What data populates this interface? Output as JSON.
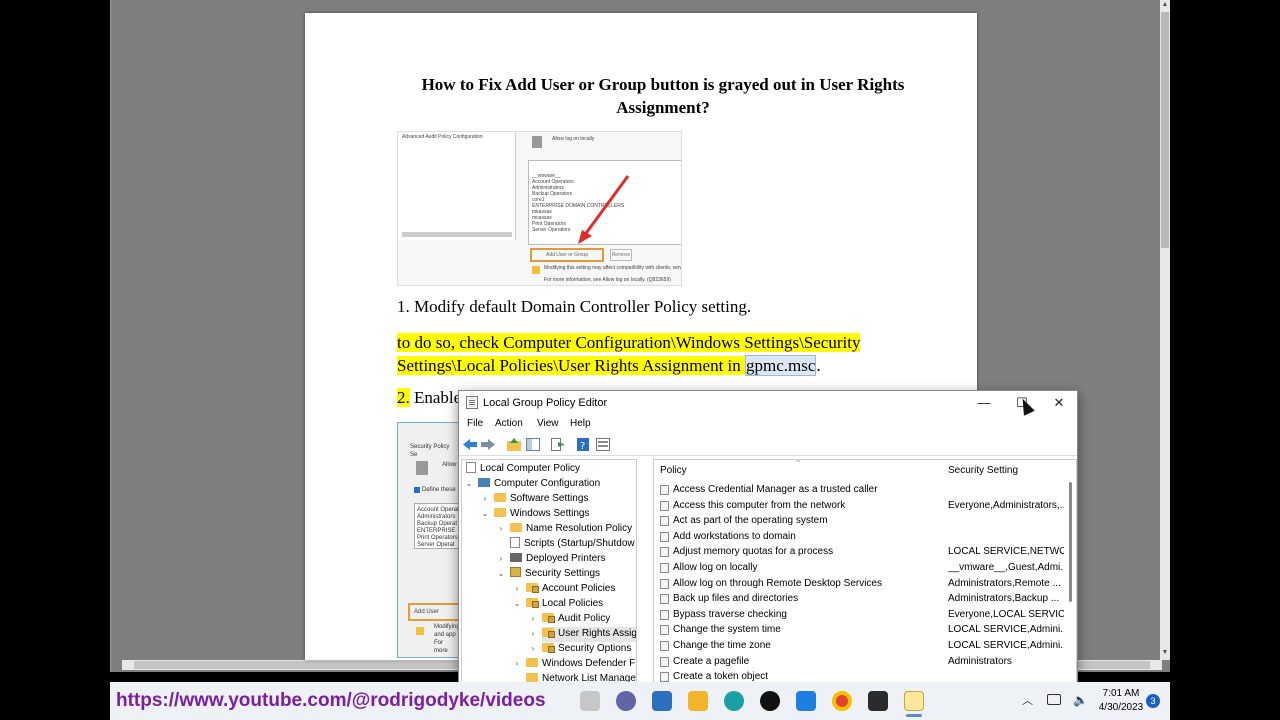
{
  "document": {
    "title": "How to Fix Add User or Group button is grayed out in User Rights Assignment?",
    "step1": "1. Modify default Domain Controller Policy setting.",
    "para_part1": "to do so, check Computer Configuration\\Windows Settings\\Security Settings\\Local Policies\\User Rights Assignment in ",
    "para_selected": "gpmc.msc",
    "para_end": ".",
    "step2_num": "2.",
    "step2_text": " Enable"
  },
  "screenshot1": {
    "tree_label": "Advanced Audit Policy Configuration",
    "policy_label": "Allow log on locally",
    "members": [
      "__vmware__",
      "Account Operators",
      "Administrators",
      "Backup Operators",
      "core1",
      "ENTERPRISE DOMAIN CONTROLLERS",
      "mkassas",
      "mcassas",
      "Print Operators",
      "Server Operators"
    ],
    "add_button": "Add User or Group",
    "remove_button": "Remove",
    "note": "Modifying this setting may affect compatibility with clients, services and applications.",
    "more_info": "For more information, see Allow log on locally. (Q823659)"
  },
  "screenshot2": {
    "title": "Security Policy Se",
    "allow": "Allow",
    "define": "Define these",
    "members": [
      "Account Operat",
      "Administrators",
      "Backup Operat",
      "ENTERPRISE",
      "Print Operators",
      "Server Operat"
    ],
    "add_button": "Add User",
    "modify_note": "Modifying",
    "and_app": "and app",
    "for_more": "For more"
  },
  "gpe_window": {
    "title": "Local Group Policy Editor",
    "minimize": "—",
    "maximize": "☐",
    "close": "✕",
    "menu": [
      "File",
      "Action",
      "View",
      "Help"
    ],
    "tree": {
      "root": "Local Computer Policy",
      "computer_config": "Computer Configuration",
      "software_settings": "Software Settings",
      "windows_settings": "Windows Settings",
      "name_resolution": "Name Resolution Policy",
      "scripts": "Scripts (Startup/Shutdow",
      "deployed_printers": "Deployed Printers",
      "security_settings": "Security Settings",
      "account_policies": "Account Policies",
      "local_policies": "Local Policies",
      "audit_policy": "Audit Policy",
      "user_rights": "User Rights Assigi",
      "security_options": "Security Options",
      "windows_defender": "Windows Defender Fi",
      "network_list": "Network List Manage"
    },
    "list_headers": {
      "policy": "Policy",
      "setting": "Security Setting"
    },
    "rows": [
      {
        "policy": "Access Credential Manager as a trusted caller",
        "setting": ""
      },
      {
        "policy": "Access this computer from the network",
        "setting": "Everyone,Administrators,..."
      },
      {
        "policy": "Act as part of the operating system",
        "setting": ""
      },
      {
        "policy": "Add workstations to domain",
        "setting": ""
      },
      {
        "policy": "Adjust memory quotas for a process",
        "setting": "LOCAL SERVICE,NETWO..."
      },
      {
        "policy": "Allow log on locally",
        "setting": "__vmware__,Guest,Admi..."
      },
      {
        "policy": "Allow log on through Remote Desktop Services",
        "setting": "Administrators,Remote ..."
      },
      {
        "policy": "Back up files and directories",
        "setting": "Administrators,Backup ..."
      },
      {
        "policy": "Bypass traverse checking",
        "setting": "Everyone,LOCAL SERVIC..."
      },
      {
        "policy": "Change the system time",
        "setting": "LOCAL SERVICE,Admini..."
      },
      {
        "policy": "Change the time zone",
        "setting": "LOCAL SERVICE,Admini..."
      },
      {
        "policy": "Create a pagefile",
        "setting": "Administrators"
      },
      {
        "policy": "Create a token object",
        "setting": ""
      }
    ]
  },
  "taskbar": {
    "url_overlay": "https://www.youtube.com/@rodrigodyke/videos",
    "time": "7:01 AM",
    "date": "4/30/2023",
    "notification_count": "3",
    "icons": [
      "file-explorer-icon",
      "teams-icon",
      "store-icon",
      "mail-icon",
      "edge-icon",
      "media-player-icon",
      "power-automate-icon",
      "chrome-icon",
      "terminal-icon",
      "notepad-icon"
    ]
  },
  "colors": {
    "highlight": "#fffb00",
    "url_overlay": "#7a1fa2",
    "viewer_bg": "#7f7f7f"
  }
}
